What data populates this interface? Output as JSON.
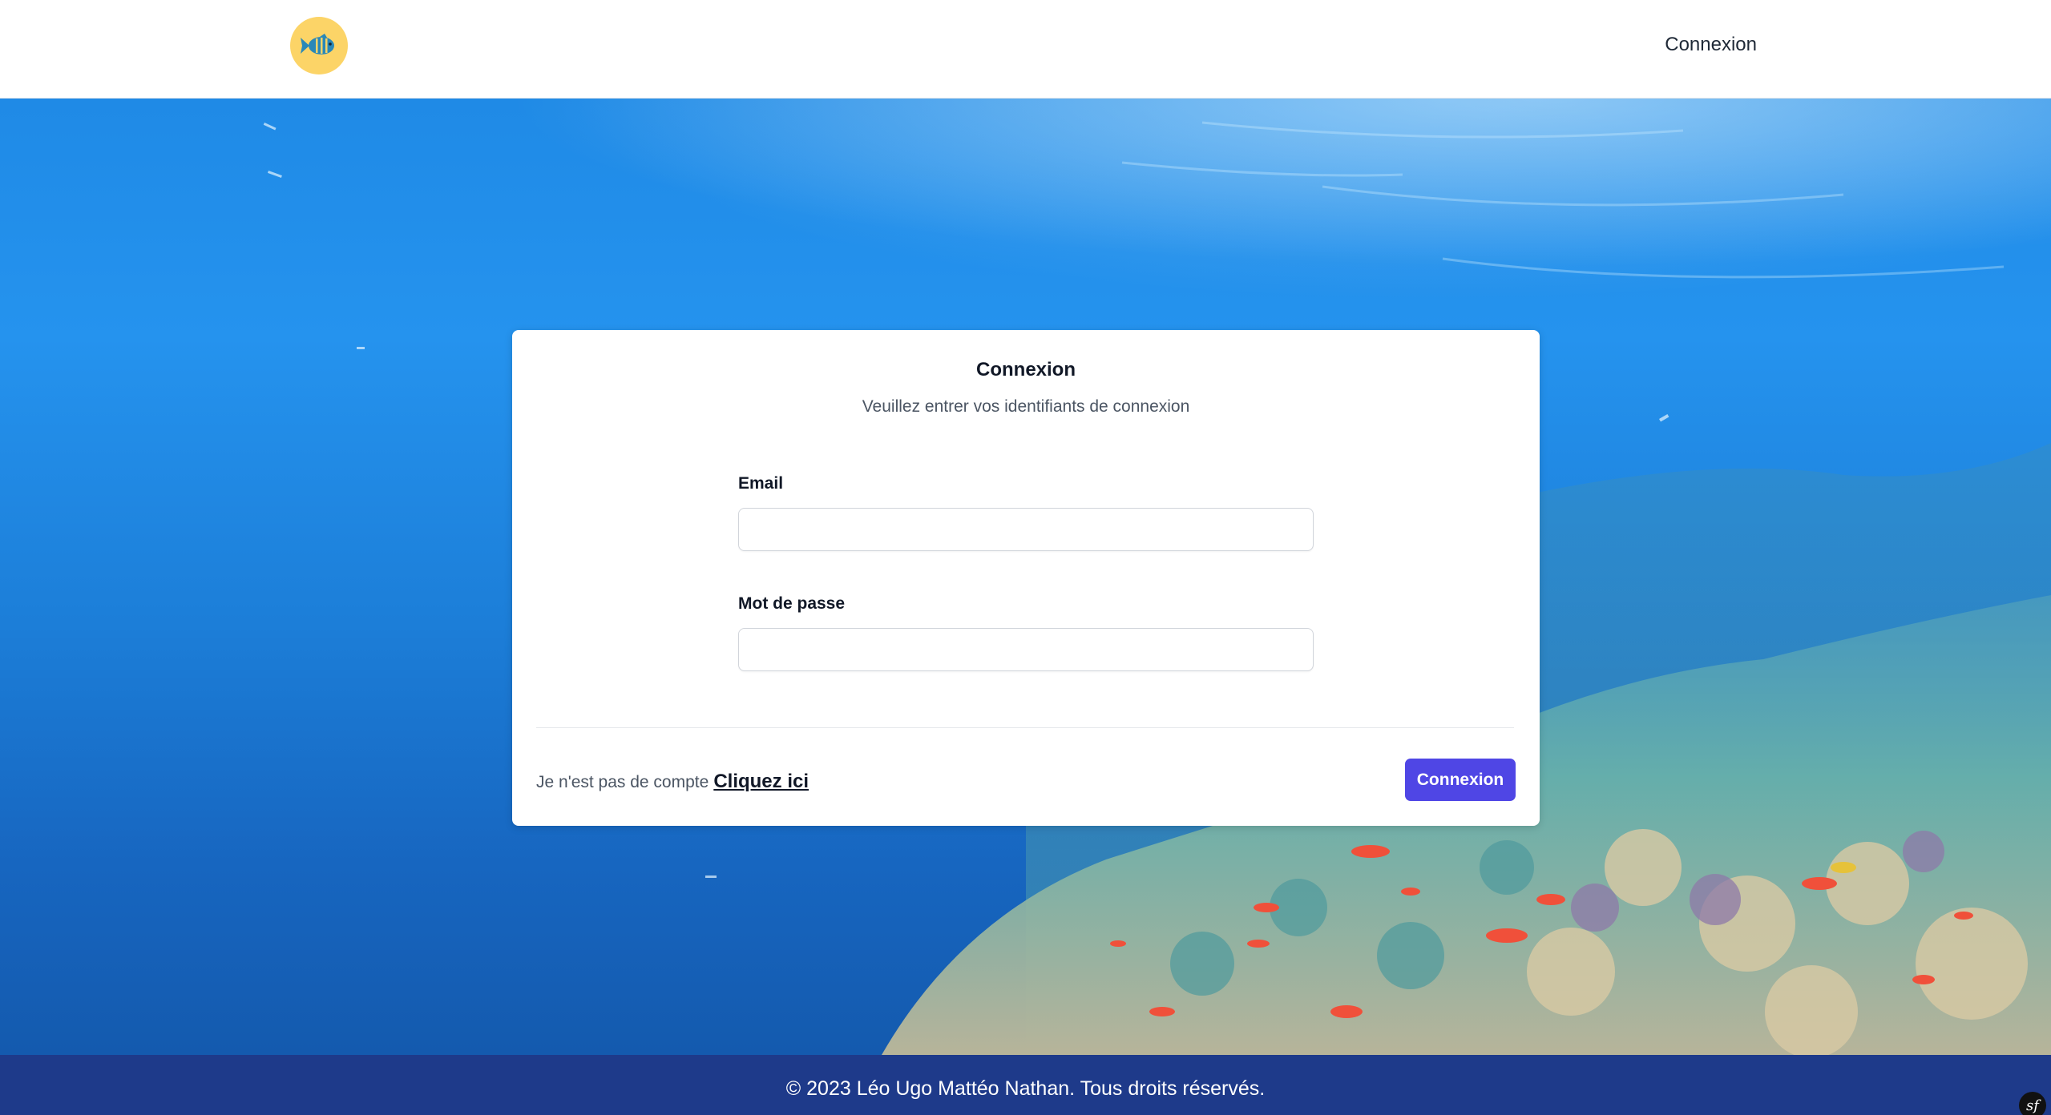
{
  "colors": {
    "accent": "#4f46e5",
    "footer_bg": "#1e3a8a",
    "logo_bg": "#fcd467",
    "water": "#2593ee"
  },
  "header": {
    "logo_icon": "fish-icon",
    "nav_login": "Connexion"
  },
  "login": {
    "title": "Connexion",
    "subtitle": "Veuillez entrer vos identifiants de connexion",
    "email_label": "Email",
    "email_value": "",
    "password_label": "Mot de passe",
    "password_value": "",
    "no_account_text": "Je n'est pas de compte",
    "signup_link": "Cliquez ici",
    "submit_label": "Connexion"
  },
  "footer": {
    "copyright": "© 2023 Léo Ugo Mattéo Nathan. Tous droits réservés.",
    "badge_icon": "symfony-icon"
  }
}
